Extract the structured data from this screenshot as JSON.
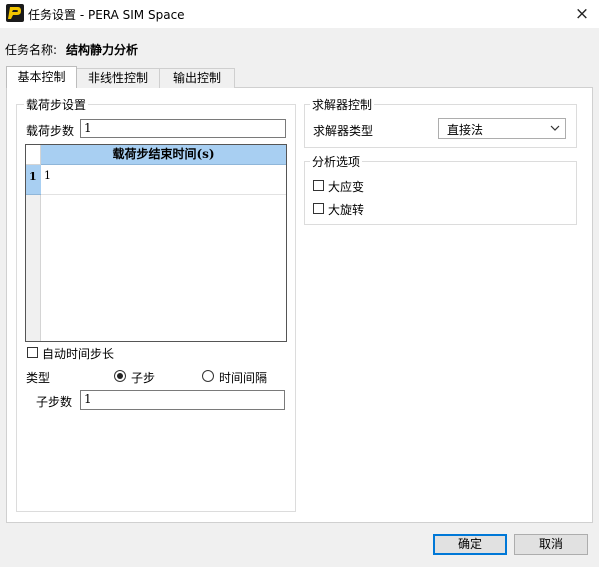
{
  "window": {
    "title": "任务设置 - PERA SIM Space",
    "close_glyph": "×"
  },
  "task": {
    "label": "任务名称:",
    "name": "结构静力分析"
  },
  "tabs": [
    {
      "label": "基本控制",
      "active": true
    },
    {
      "label": "非线性控制",
      "active": false
    },
    {
      "label": "输出控制",
      "active": false
    }
  ],
  "load_settings": {
    "title": "载荷步设置",
    "steps_label": "载荷步数",
    "steps_value": "1",
    "grid": {
      "header": "载荷步结束时间(s)",
      "rows": [
        {
          "index": "1",
          "value": "1"
        }
      ]
    },
    "auto_step_label": "自动时间步长",
    "auto_step_checked": false,
    "type_label": "类型",
    "type_options": [
      {
        "label": "子步",
        "selected": true
      },
      {
        "label": "时间间隔",
        "selected": false
      }
    ],
    "substeps_label": "子步数",
    "substeps_value": "1"
  },
  "solver": {
    "title": "求解器控制",
    "type_label": "求解器类型",
    "type_value": "直接法"
  },
  "analysis": {
    "title": "分析选项",
    "options": [
      {
        "label": "大应变",
        "checked": false
      },
      {
        "label": "大旋转",
        "checked": false
      }
    ]
  },
  "buttons": {
    "ok": "确定",
    "cancel": "取消"
  },
  "colors": {
    "grid_header": "#a8cff2",
    "focus_border": "#0078d7",
    "app_icon": "#f2c500"
  }
}
